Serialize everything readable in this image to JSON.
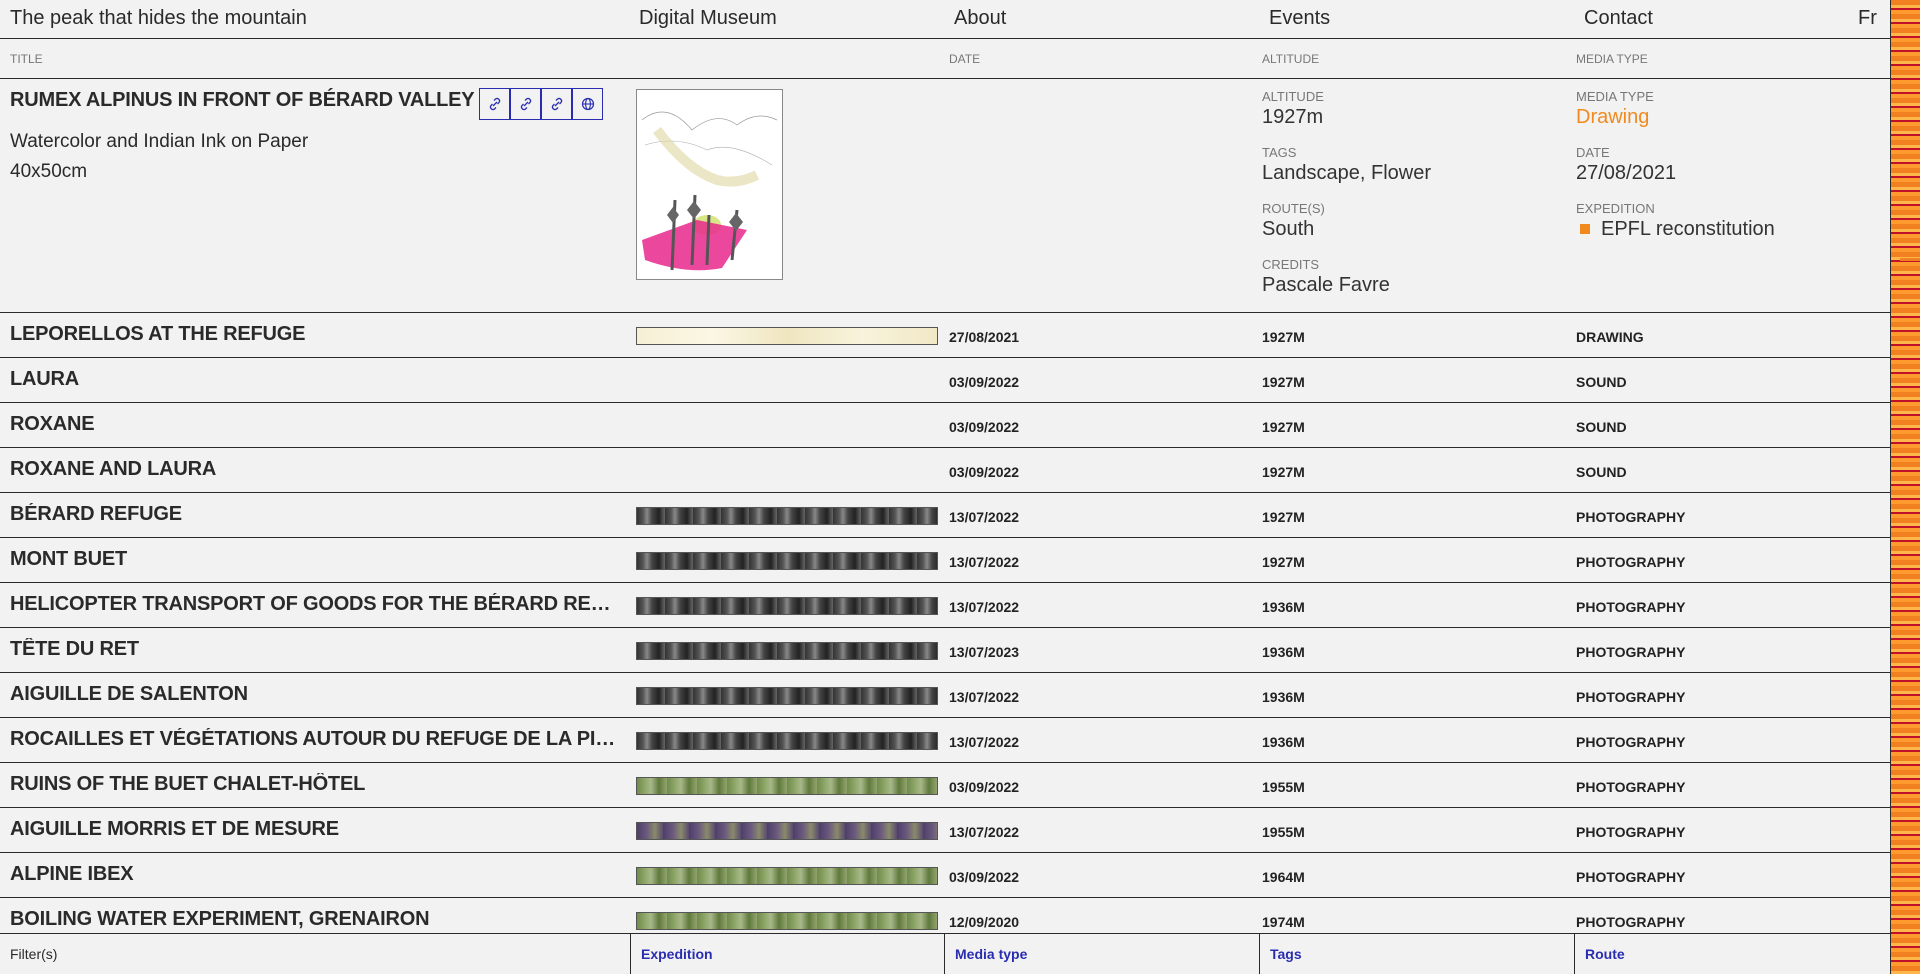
{
  "nav": {
    "title": "The peak that hides the mountain",
    "digital_museum": "Digital Museum",
    "about": "About",
    "events": "Events",
    "contact": "Contact",
    "lang": "Fr"
  },
  "columns": {
    "title": "TITLE",
    "date": "DATE",
    "altitude": "ALTITUDE",
    "media_type": "MEDIA TYPE"
  },
  "selected": {
    "title": "RUMEX ALPINUS IN FRONT OF BÉRARD VALLEY",
    "medium": "Watercolor and Indian Ink on Paper",
    "size": "40x50cm",
    "icons": [
      "link-icon",
      "link-icon",
      "link-icon",
      "globe-icon"
    ],
    "altitude_label": "ALTITUDE",
    "altitude": "1927m",
    "tags_label": "TAGS",
    "tags": "Landscape, Flower",
    "routes_label": "ROUTE(S)",
    "routes": "South",
    "credits_label": "CREDITS",
    "credits": "Pascale Favre",
    "media_type_label": "MEDIA TYPE",
    "media_type": "Drawing",
    "date_label": "DATE",
    "date": "27/08/2021",
    "expedition_label": "EXPEDITION",
    "expedition": "EPFL reconstitution",
    "accent_color": "#f08a1e"
  },
  "rows": [
    {
      "title": "LEPORELLOS AT THE REFUGE",
      "date": "27/08/2021",
      "altitude": "1927M",
      "media": "DRAWING",
      "thumb": "paper"
    },
    {
      "title": "LAURA",
      "date": "03/09/2022",
      "altitude": "1927M",
      "media": "SOUND",
      "thumb": "none"
    },
    {
      "title": "ROXANE",
      "date": "03/09/2022",
      "altitude": "1927M",
      "media": "SOUND",
      "thumb": "none"
    },
    {
      "title": "ROXANE AND LAURA",
      "date": "03/09/2022",
      "altitude": "1927M",
      "media": "SOUND",
      "thumb": "none"
    },
    {
      "title": "BÉRARD REFUGE",
      "date": "13/07/2022",
      "altitude": "1927M",
      "media": "PHOTOGRAPHY",
      "thumb": "bw"
    },
    {
      "title": "MONT BUET",
      "date": "13/07/2022",
      "altitude": "1927M",
      "media": "PHOTOGRAPHY",
      "thumb": "bw"
    },
    {
      "title": "HELICOPTER TRANSPORT OF GOODS FOR THE BÉRARD REFUGE",
      "date": "13/07/2022",
      "altitude": "1936M",
      "media": "PHOTOGRAPHY",
      "thumb": "bw"
    },
    {
      "title": "TÊTE DU RET",
      "date": "13/07/2023",
      "altitude": "1936M",
      "media": "PHOTOGRAPHY",
      "thumb": "bw"
    },
    {
      "title": "AIGUILLE DE SALENTON",
      "date": "13/07/2022",
      "altitude": "1936M",
      "media": "PHOTOGRAPHY",
      "thumb": "bw"
    },
    {
      "title": "ROCAILLES ET VÉGÉTATIONS AUTOUR DU REFUGE DE LA PIERRE À BÉRARD",
      "date": "13/07/2022",
      "altitude": "1936M",
      "media": "PHOTOGRAPHY",
      "thumb": "bw"
    },
    {
      "title": "RUINS OF THE BUET CHALET-HÔTEL",
      "date": "03/09/2022",
      "altitude": "1955M",
      "media": "PHOTOGRAPHY",
      "thumb": "green"
    },
    {
      "title": "AIGUILLE MORRIS ET DE MESURE",
      "date": "13/07/2022",
      "altitude": "1955M",
      "media": "PHOTOGRAPHY",
      "thumb": "purple"
    },
    {
      "title": "ALPINE IBEX",
      "date": "03/09/2022",
      "altitude": "1964M",
      "media": "PHOTOGRAPHY",
      "thumb": "green"
    },
    {
      "title": "BOILING WATER EXPERIMENT, GRENAIRON",
      "date": "12/09/2020",
      "altitude": "1974M",
      "media": "PHOTOGRAPHY",
      "thumb": "green"
    }
  ],
  "filters": {
    "label": "Filter(s)",
    "expedition": "Expedition",
    "media_type": "Media type",
    "tags": "Tags",
    "route": "Route"
  }
}
